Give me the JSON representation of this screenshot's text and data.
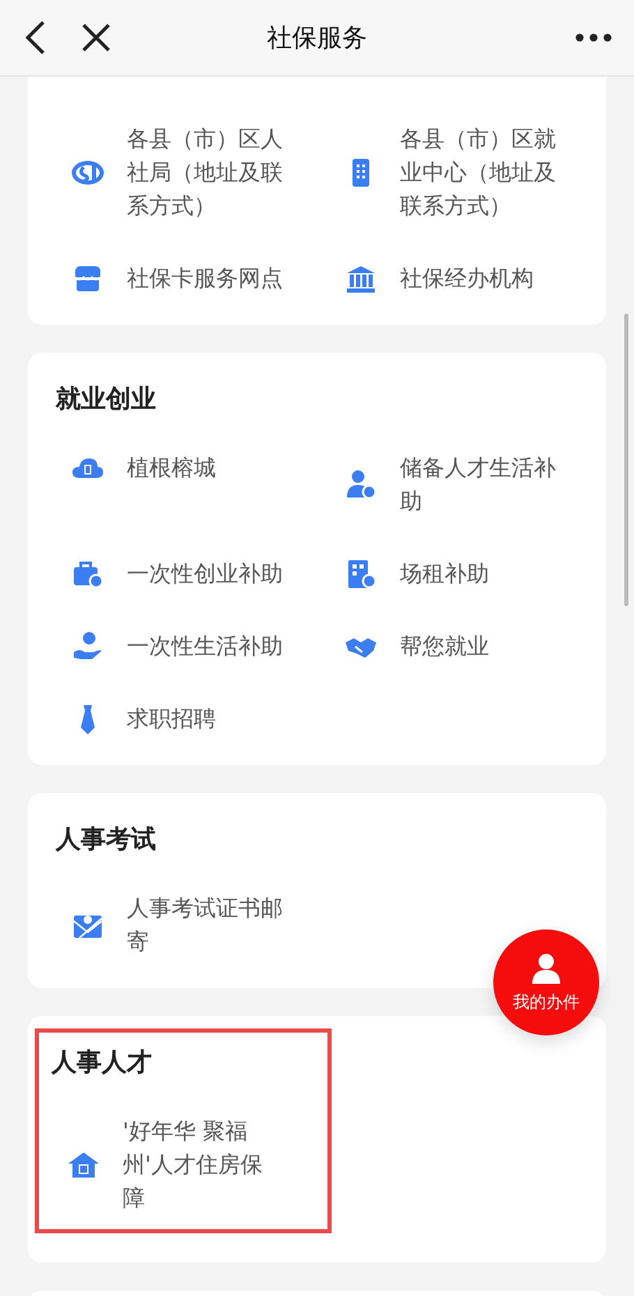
{
  "header": {
    "title": "社保服务"
  },
  "sections": [
    {
      "items": [
        {
          "label": "各县（市）区人社局（地址及联系方式）"
        },
        {
          "label": "各县（市）区就业中心（地址及联系方式）"
        },
        {
          "label": "社保卡服务网点"
        },
        {
          "label": "社保经办机构"
        }
      ]
    },
    {
      "title": "就业创业",
      "items": [
        {
          "label": "植根榕城"
        },
        {
          "label": "储备人才生活补助"
        },
        {
          "label": "一次性创业补助"
        },
        {
          "label": "场租补助"
        },
        {
          "label": "一次性生活补助"
        },
        {
          "label": "帮您就业"
        },
        {
          "label": "求职招聘"
        }
      ]
    },
    {
      "title": "人事考试",
      "items": [
        {
          "label": "人事考试证书邮寄"
        }
      ]
    },
    {
      "title": "人事人才",
      "highlighted": true,
      "items": [
        {
          "label": "'好年华 聚福州'人才住房保障"
        }
      ]
    }
  ],
  "fab": {
    "label": "我的办件"
  }
}
